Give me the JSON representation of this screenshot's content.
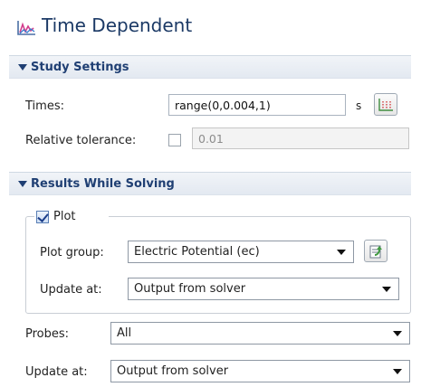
{
  "panel": {
    "title": "Time Dependent",
    "title_icon": "time-dependent-study-icon"
  },
  "study_settings": {
    "header": "Study Settings",
    "times_label": "Times:",
    "times_value": "range(0,0.004,1)",
    "times_unit": "s",
    "range_button_icon": "range-chart-icon",
    "rel_tol_label": "Relative tolerance:",
    "rel_tol_checked": false,
    "rel_tol_value": "0.01"
  },
  "results_while_solving": {
    "header": "Results While Solving",
    "plot_label": "Plot",
    "plot_checked": true,
    "plot_group_label": "Plot group:",
    "plot_group_value": "Electric Potential (ec)",
    "plot_group_button_icon": "go-to-plot-icon",
    "plot_update_label": "Update at:",
    "plot_update_value": "Output from solver",
    "probes_label": "Probes:",
    "probes_value": "All",
    "probes_update_label": "Update at:",
    "probes_update_value": "Output from solver"
  },
  "colors": {
    "title": "#1c3a66",
    "section_header_text": "#1f3f73",
    "section_header_bg": "#e3e9f1"
  }
}
